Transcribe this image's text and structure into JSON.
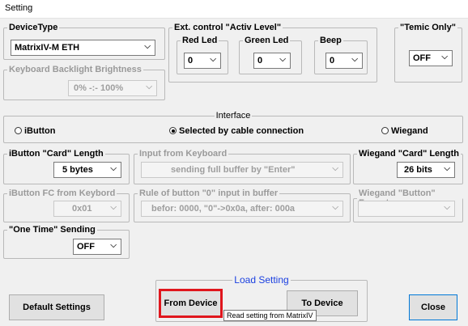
{
  "window": {
    "title": "Setting"
  },
  "device_type": {
    "label": "DeviceType",
    "value": "MatrixIV-M ETH"
  },
  "ext_control": {
    "label": "Ext. control  \"Activ Level\"",
    "red_led": {
      "label": "Red Led",
      "value": "0"
    },
    "green_led": {
      "label": "Green Led",
      "value": "0"
    },
    "beep": {
      "label": "Beep",
      "value": "0"
    }
  },
  "temic_only": {
    "label": "\"Temic Only\"",
    "value": "OFF"
  },
  "keyboard_backlight": {
    "label": "Keyboard Backlight Brightness",
    "value": "0% -:- 100%"
  },
  "interface": {
    "label": "Interface",
    "options": [
      {
        "label": "iButton",
        "selected": false
      },
      {
        "label": "Selected by cable connection",
        "selected": true
      },
      {
        "label": "Wiegand",
        "selected": false
      }
    ]
  },
  "ibutton_card_length": {
    "label": "iButton \"Card\" Length",
    "value": "5 bytes"
  },
  "input_from_keyboard": {
    "label": "Input from Keyboard",
    "value": "sending full buffer by \"Enter\""
  },
  "wiegand_card_length": {
    "label": "Wiegand \"Card\" Length",
    "value": "26 bits"
  },
  "ibutton_fc": {
    "label": "iButton FC from Keybord",
    "value": "0x01"
  },
  "rule_button_0": {
    "label": "Rule of button \"0\" input in buffer",
    "value": "befor: 0000, \"0\"->0x0a, after: 000a"
  },
  "wiegand_button_format": {
    "label": "Wiegand \"Button\" Format",
    "value": ""
  },
  "one_time_sending": {
    "label": "\"One Time\" Sending",
    "value": "OFF"
  },
  "load_setting": {
    "label": "Load Setting",
    "from_device": "From Device",
    "to_device": "To Device"
  },
  "tooltip": "Read setting from MatrixIV",
  "buttons": {
    "default_settings": "Default Settings",
    "close": "Close"
  },
  "colors": {
    "highlight_border": "#e0161d",
    "group_title_blue": "#1a3fe0",
    "close_border": "#0078d7"
  }
}
